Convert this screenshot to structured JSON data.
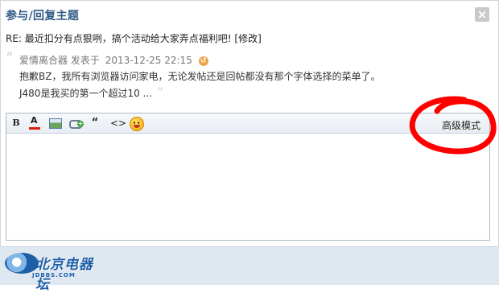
{
  "dialog": {
    "title": "参与/回复主题",
    "close_glyph": "×"
  },
  "thread": {
    "title": "RE: 最近扣分有点狠咧，搞个活动给大家弄点福利吧! [修改]"
  },
  "quote": {
    "open_mark": "“",
    "author": "爱情离合器",
    "posted_label": "发表于",
    "time": "2013-12-25 22:15",
    "reply_icon": "reply-arrow-icon",
    "line1": "抱歉BZ，我所有浏览器访问家电，无论发帖还是回帖都没有那个字体选择的菜单了。",
    "line2": "J480是我买的第一个超过10 ...",
    "close_mark": "”"
  },
  "toolbar": {
    "bold": "B",
    "font_color": "A",
    "quote_btn": "“",
    "code_btn": "<>",
    "advanced_mode": "高级模式",
    "icons": [
      "bold-icon",
      "font-color-icon",
      "image-icon",
      "link-icon",
      "quote-icon",
      "code-icon",
      "smiley-icon"
    ],
    "font_color_value": "#d81e06"
  },
  "annotation": {
    "color": "#ff0000",
    "shape": "hand-drawn circle around advanced mode"
  },
  "footer": {
    "logo_text": "北京电器坛",
    "logo_url_text": "JDBBS.COM"
  }
}
